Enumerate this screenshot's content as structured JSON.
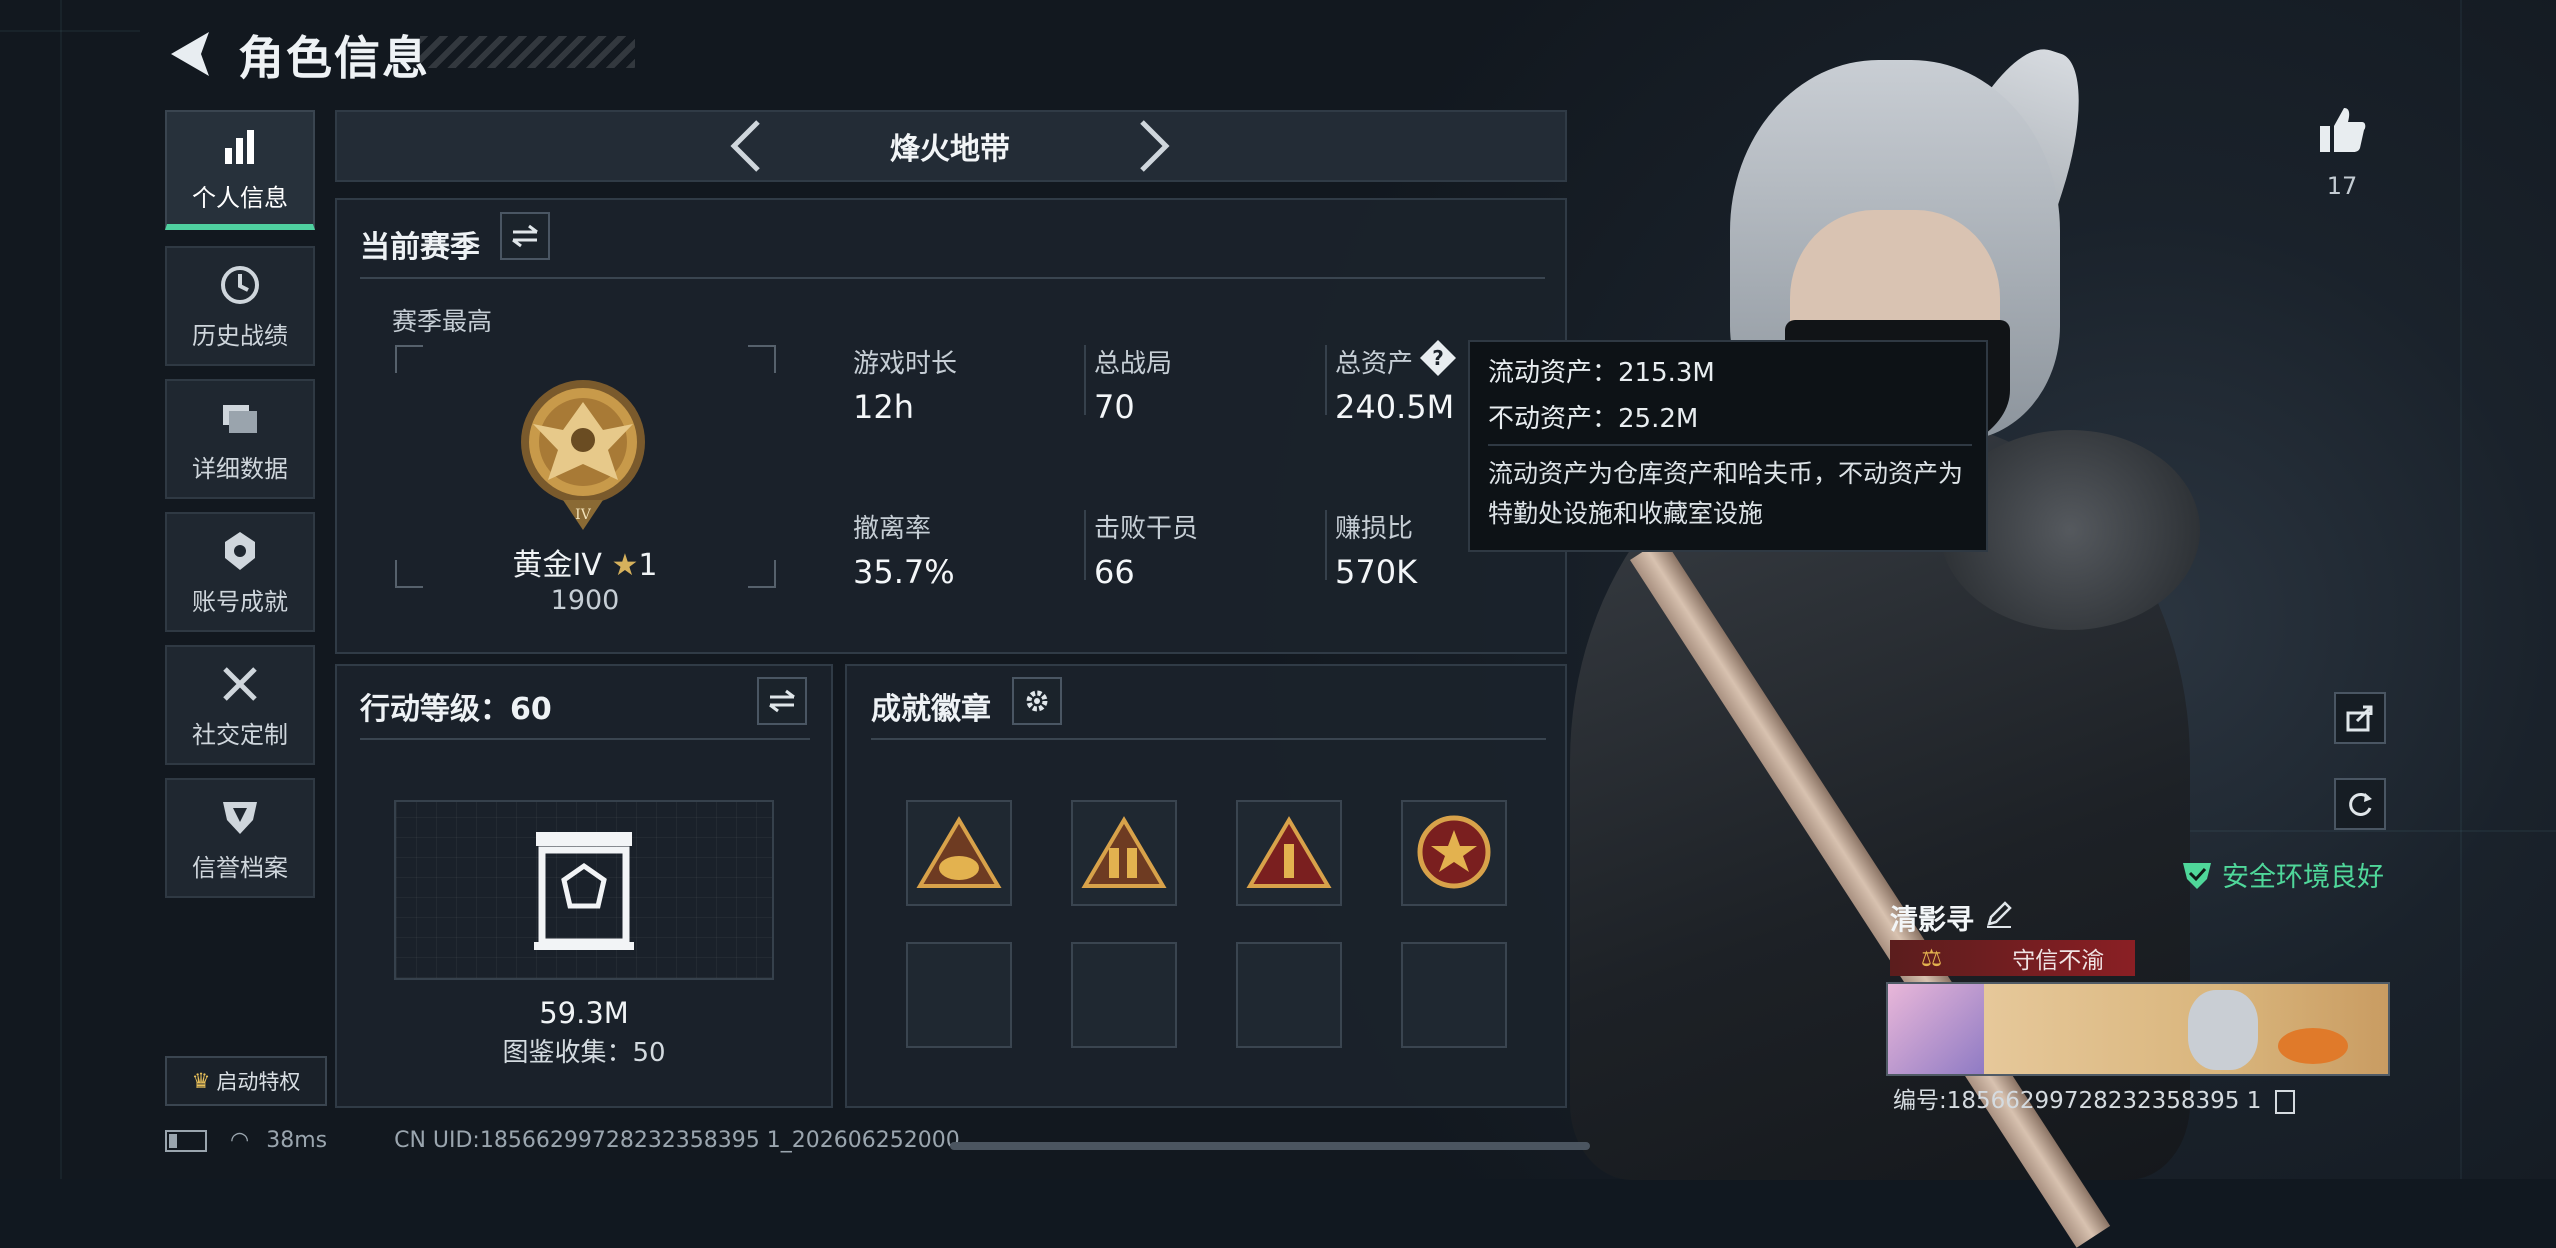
{
  "header": {
    "title": "角色信息"
  },
  "sidebar": {
    "items": [
      {
        "label": "个人信息",
        "icon": "bar-chart-icon",
        "active": true
      },
      {
        "label": "历史战绩",
        "icon": "history-clock-icon"
      },
      {
        "label": "详细数据",
        "icon": "folder-icon"
      },
      {
        "label": "账号成就",
        "icon": "trophy-icon"
      },
      {
        "label": "社交定制",
        "icon": "tools-icon"
      },
      {
        "label": "信誉档案",
        "icon": "shield-icon"
      }
    ],
    "privilege_label": "启动特权"
  },
  "mode": {
    "label": "烽火地带"
  },
  "season": {
    "title": "当前赛季",
    "best_label": "赛季最高",
    "rank_name": "黄金IV",
    "rank_stars": "1",
    "rank_score": "1900",
    "rank_numeral": "IV",
    "stats": [
      {
        "label": "游戏时长",
        "value": "12h"
      },
      {
        "label": "总战局",
        "value": "70"
      },
      {
        "label": "总资产",
        "value": "240.5M"
      },
      {
        "label": "撤离率",
        "value": "35.7%"
      },
      {
        "label": "击败干员",
        "value": "66"
      },
      {
        "label": "赚损比",
        "value": "570K"
      }
    ]
  },
  "tooltip": {
    "liquid": "流动资产：215.3M",
    "fixed": "不动资产：25.2M",
    "note": "流动资产为仓库资产和哈夫币，不动资产为特勤处设施和收藏室设施"
  },
  "action_level": {
    "title": "行动等级：60",
    "value": "59.3M",
    "collection": "图鉴收集：50"
  },
  "badges": {
    "title": "成就徽章"
  },
  "right_panel": {
    "like_count": "17",
    "safe_status": "安全环境良好",
    "nickname": "清影寻",
    "title_tag": "守信不渝",
    "player_id": "编号:18566299728232358395 1"
  },
  "footer": {
    "ping": "38ms",
    "uid": "CN UID:18566299728232358395 1_202606252000"
  },
  "colors": {
    "accent_green": "#4fd1a0",
    "safe_green": "#4fd79a",
    "tag_red": "#8a1f24",
    "gold": "#c89a4a"
  }
}
